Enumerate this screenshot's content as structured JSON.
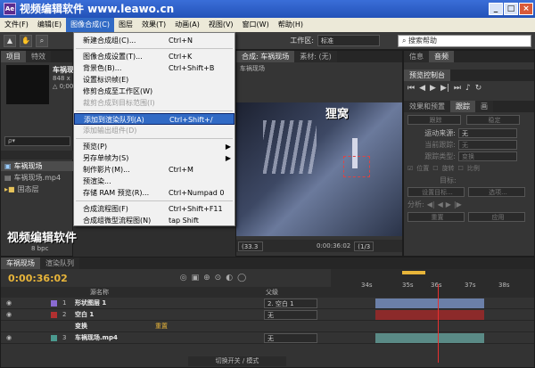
{
  "window": {
    "title": "视频编辑软件 www.leawo.cn",
    "minimize": "_",
    "maximize": "□",
    "close": "×",
    "app_badge": "Ae"
  },
  "menubar": [
    "文件(F)",
    "编辑(E)",
    "图像合成(C)",
    "图层",
    "效果(T)",
    "动画(A)",
    "视图(V)",
    "窗口(W)",
    "帮助(H)"
  ],
  "toolbar": {
    "workspace_label": "工作区:",
    "workspace_value": "标准",
    "search_placeholder": "搜索帮助"
  },
  "menu": {
    "items": [
      {
        "label": "新建合成组(C)...",
        "shortcut": "Ctrl+N",
        "state": "normal"
      },
      {
        "sep": true
      },
      {
        "label": "图像合成设置(T)...",
        "shortcut": "Ctrl+K",
        "state": "normal"
      },
      {
        "label": "背景色(B)...",
        "shortcut": "Ctrl+Shift+B",
        "state": "normal"
      },
      {
        "label": "设置标识帧(E)",
        "shortcut": "",
        "state": "normal"
      },
      {
        "label": "修剪合成至工作区(W)",
        "shortcut": "",
        "state": "normal"
      },
      {
        "label": "裁剪合成到目标范围(I)",
        "shortcut": "",
        "state": "disabled"
      },
      {
        "sep": true
      },
      {
        "label": "添加到渲染队列(A)",
        "shortcut": "Ctrl+Shift+/",
        "state": "highlight"
      },
      {
        "label": "添加输出组件(D)",
        "shortcut": "",
        "state": "disabled"
      },
      {
        "sep": true
      },
      {
        "label": "预览(P)",
        "shortcut": "",
        "state": "submenu"
      },
      {
        "label": "另存单帧为(S)",
        "shortcut": "",
        "state": "submenu"
      },
      {
        "label": "制作影片(M)...",
        "shortcut": "Ctrl+M",
        "state": "normal"
      },
      {
        "label": "预渲染...",
        "shortcut": "",
        "state": "normal"
      },
      {
        "label": "存储 RAM 预览(R)...",
        "shortcut": "Ctrl+Numpad 0",
        "state": "normal"
      },
      {
        "sep": true
      },
      {
        "label": "合成流程图(F)",
        "shortcut": "Ctrl+Shift+F11",
        "state": "normal"
      },
      {
        "label": "合成组微型流程图(N)",
        "shortcut": "tap Shift",
        "state": "normal"
      }
    ]
  },
  "project": {
    "tabs": [
      "项目",
      "特效"
    ],
    "thumb_title": "车祸现",
    "thumb_info": [
      "848 x",
      "△ 0;00"
    ],
    "search_placeholder": "ρ▾",
    "files": [
      "车祸现场",
      "车祸现场.mp4",
      "固态层"
    ],
    "bpc": "8 bpc"
  },
  "composition": {
    "tab": "合成: 车祸现场",
    "footage_tab": "素材: (无)",
    "breadcrumb": "车祸现场",
    "zoom": "(33.3",
    "time": "0:00:36:02",
    "res": "(1/3"
  },
  "right": {
    "tabs": [
      "信息",
      "音频"
    ],
    "preview_tab": "预览控制台",
    "effects_tabs": [
      "效果和预置",
      "跟踪",
      "画"
    ],
    "track": {
      "btn1": "跟踪",
      "btn2": "稳定",
      "motion_source_label": "运动来源:",
      "motion_source": "无",
      "current_track_label": "当前跟踪:",
      "current_track": "无",
      "track_type_label": "跟踪类型:",
      "track_type": "变换",
      "check_pos": "位置",
      "check_rot": "旋转",
      "check_scale": "比例",
      "target_label": "目标:",
      "set_target": "设置目标...",
      "options": "选项...",
      "analyze": "分析:",
      "reset": "重置",
      "apply": "应用"
    }
  },
  "timeline": {
    "tabs": [
      "车祸现场",
      "渲染队列"
    ],
    "time": "0:00:36:02",
    "col_name": "源名称",
    "col_parent": "父级",
    "ruler": [
      "34s",
      "35s",
      "36s",
      "37s",
      "38s"
    ],
    "layers": [
      {
        "num": "1",
        "name": "形状图层 1",
        "parent": "2. 空白 1",
        "color": "#8a6bd1"
      },
      {
        "num": "2",
        "name": "空白 1",
        "parent": "无",
        "color": "#b13030"
      },
      {
        "num": "",
        "name": "变换",
        "parent": "",
        "sub": "重置",
        "color": ""
      },
      {
        "num": "3",
        "name": "车祸现场.mp4",
        "parent": "无",
        "color": "#4b9a8f"
      }
    ],
    "footer": "切换开关 / 模式"
  },
  "watermarks": {
    "overlay": "视频编辑软件",
    "logo": "狸窝"
  }
}
